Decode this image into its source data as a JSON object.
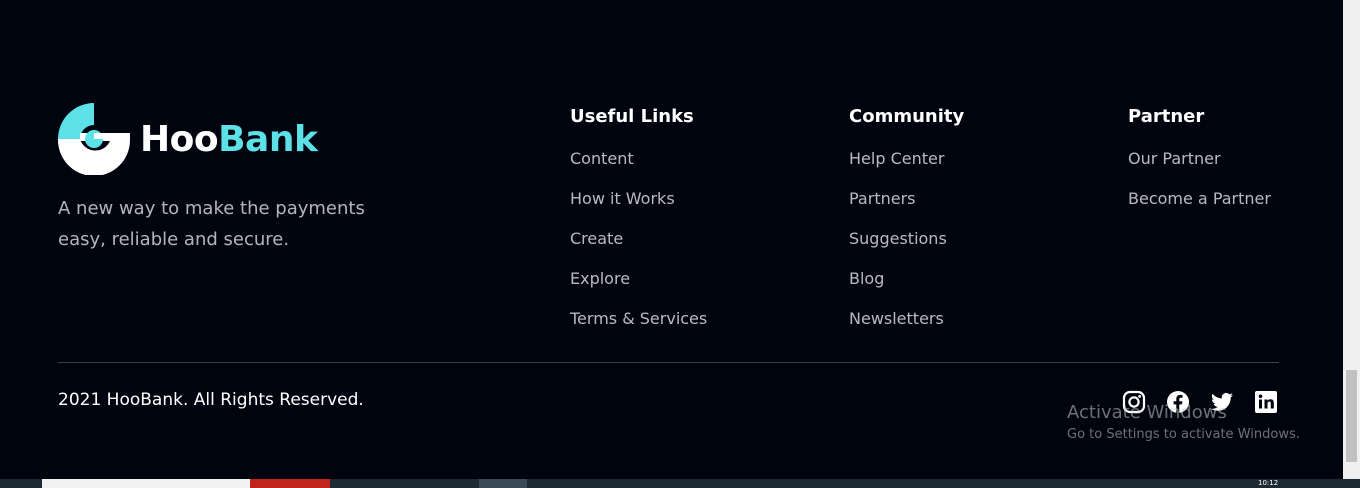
{
  "logo": {
    "brand_part1": "Hoo",
    "brand_part2": "Bank",
    "accent_color": "#5ce1e6"
  },
  "tagline": "A new way to make the payments easy, reliable and secure.",
  "columns": [
    {
      "title": "Useful Links",
      "links": [
        "Content",
        "How it Works",
        "Create",
        "Explore",
        "Terms & Services"
      ]
    },
    {
      "title": "Community",
      "links": [
        "Help Center",
        "Partners",
        "Suggestions",
        "Blog",
        "Newsletters"
      ]
    },
    {
      "title": "Partner",
      "links": [
        "Our Partner",
        "Become a Partner"
      ]
    }
  ],
  "copyright": "2021 HooBank. All Rights Reserved.",
  "socials": [
    "instagram-icon",
    "facebook-icon",
    "twitter-icon",
    "linkedin-icon"
  ],
  "watermark": {
    "line1": "Activate Windows",
    "line2": "Go to Settings to activate Windows."
  },
  "taskbar": {
    "clock": "10:12"
  }
}
